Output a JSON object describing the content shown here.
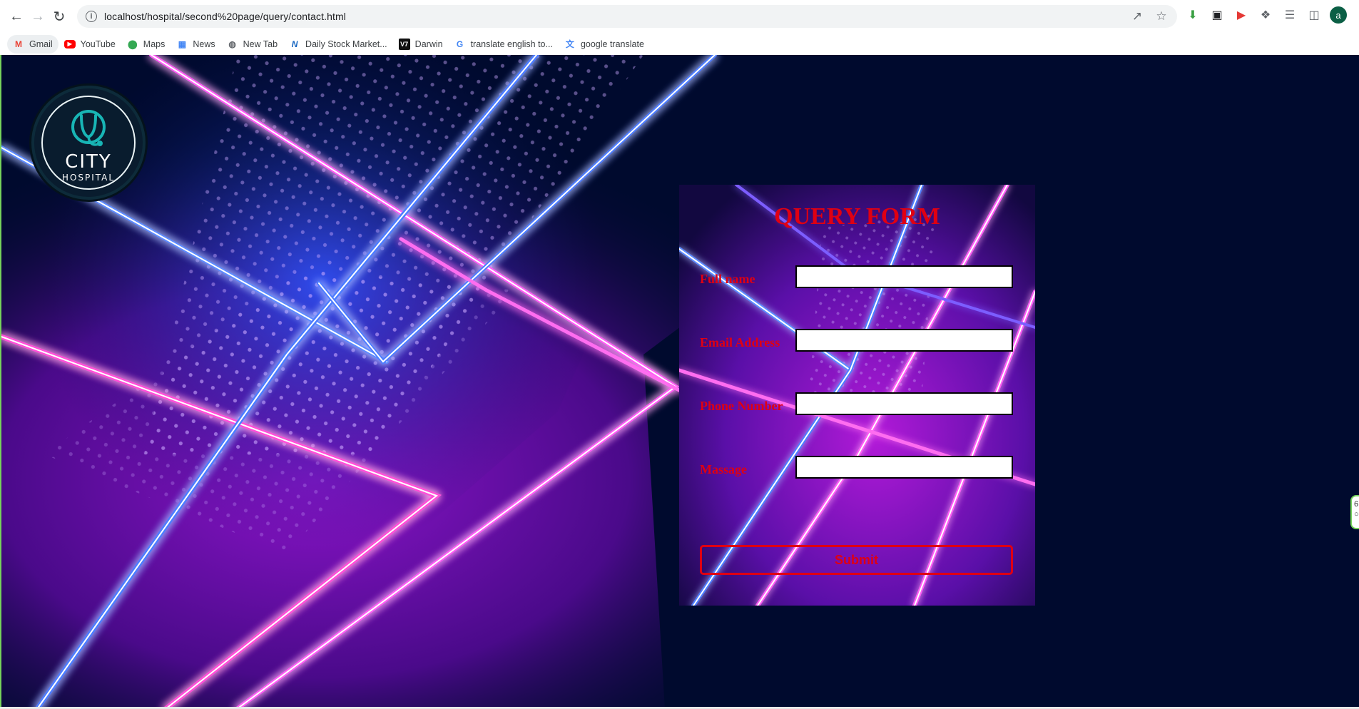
{
  "browser": {
    "url": "localhost/hospital/second%20page/query/contact.html",
    "profile_initial": "a",
    "bookmarks": [
      {
        "label": "Gmail",
        "icon": "gmail-icon",
        "glyph": "M"
      },
      {
        "label": "YouTube",
        "icon": "youtube-icon",
        "glyph": "▶"
      },
      {
        "label": "Maps",
        "icon": "maps-icon",
        "glyph": "⬤"
      },
      {
        "label": "News",
        "icon": "news-icon",
        "glyph": "▦"
      },
      {
        "label": "New Tab",
        "icon": "globe-icon",
        "glyph": "◍"
      },
      {
        "label": "Daily Stock Market...",
        "icon": "stock-icon",
        "glyph": "N"
      },
      {
        "label": "Darwin",
        "icon": "darwin-icon",
        "glyph": "V7"
      },
      {
        "label": "translate english to...",
        "icon": "google-icon",
        "glyph": "G"
      },
      {
        "label": "google translate",
        "icon": "translate-icon",
        "glyph": "文"
      }
    ]
  },
  "page": {
    "logo": {
      "line1": "CITY",
      "line2": "HOSPITAL"
    },
    "form": {
      "title": "QUERY FORM",
      "fields": [
        {
          "label": "Full name",
          "value": ""
        },
        {
          "label": "Email Address",
          "value": ""
        },
        {
          "label": "Phone Number",
          "value": ""
        },
        {
          "label": "Massage",
          "value": ""
        }
      ],
      "submit_label": "Submit"
    }
  },
  "colors": {
    "form_text": "#e00012",
    "background_dark": "#000a2e",
    "neon_magenta": "#e040fb",
    "neon_blue": "#3d7bff"
  }
}
